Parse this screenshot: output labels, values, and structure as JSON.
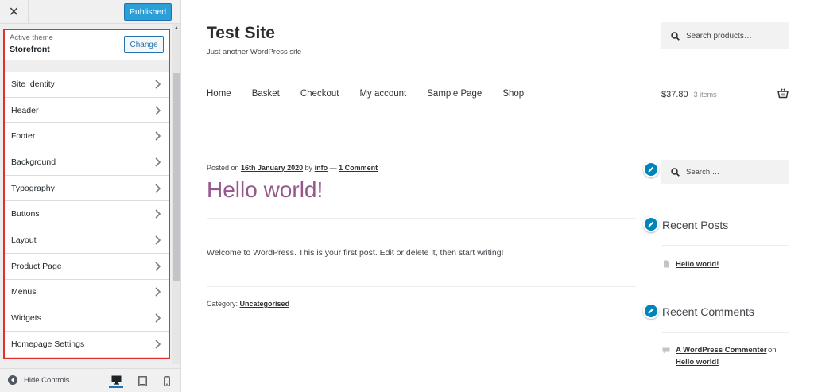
{
  "customizer": {
    "close_symbol": "✕",
    "publish_label": "Published",
    "theme": {
      "caption": "Active theme",
      "name": "Storefront",
      "change_label": "Change"
    },
    "panels": [
      {
        "label": "Site Identity"
      },
      {
        "label": "Header"
      },
      {
        "label": "Footer"
      },
      {
        "label": "Background"
      },
      {
        "label": "Typography"
      },
      {
        "label": "Buttons"
      },
      {
        "label": "Layout"
      },
      {
        "label": "Product Page"
      },
      {
        "label": "Menus"
      },
      {
        "label": "Widgets"
      },
      {
        "label": "Homepage Settings"
      }
    ],
    "footer": {
      "hide_controls_label": "Hide Controls",
      "devices": [
        "desktop-icon",
        "tablet-icon",
        "mobile-icon"
      ]
    },
    "colors": {
      "accent": "#2271b1",
      "highlight_border": "#e03131"
    }
  },
  "site": {
    "title": "Test Site",
    "tagline": "Just another WordPress site",
    "search_placeholder": "Search products…",
    "nav": [
      "Home",
      "Basket",
      "Checkout",
      "My account",
      "Sample Page",
      "Shop"
    ],
    "cart": {
      "amount": "$37.80",
      "items": "3 items"
    },
    "post": {
      "meta_prefix": "Posted on",
      "date": "16th January 2020",
      "by": "by",
      "author": "info",
      "sep": "—",
      "comments": "1 Comment",
      "title": "Hello world!",
      "body": "Welcome to WordPress. This is your first post. Edit or delete it, then start writing!",
      "category_prefix": "Category:",
      "category": "Uncategorised"
    },
    "sidebar": {
      "search_placeholder": "Search …",
      "recent_posts_title": "Recent Posts",
      "recent_post": "Hello world!",
      "recent_comments_title": "Recent Comments",
      "commenter": "A WordPress Commenter",
      "on": "on",
      "comment_post": "Hello world!"
    },
    "colors": {
      "title": "#96588a",
      "edit_pin": "#0085ba"
    }
  }
}
